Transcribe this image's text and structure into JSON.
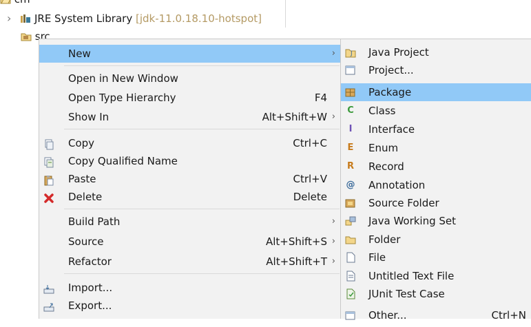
{
  "tree": {
    "project_label": "cm",
    "jre_label": "JRE System Library",
    "jre_decoration": "[jdk-11.0.18.10-hotspot]",
    "src_label": "src",
    "expand_glyph": "›"
  },
  "context_menu": {
    "items": [
      {
        "label": "New",
        "accel": "",
        "arrow": "›"
      },
      {
        "label": "Open in New Window",
        "accel": "",
        "arrow": ""
      },
      {
        "label": "Open Type Hierarchy",
        "accel": "F4",
        "arrow": ""
      },
      {
        "label": "Show In",
        "accel": "Alt+Shift+W",
        "arrow": "›"
      },
      {
        "label": "Copy",
        "accel": "Ctrl+C",
        "arrow": "",
        "icon": "copy-icon"
      },
      {
        "label": "Copy Qualified Name",
        "accel": "",
        "arrow": "",
        "icon": "copy-qualified-name-icon"
      },
      {
        "label": "Paste",
        "accel": "Ctrl+V",
        "arrow": "",
        "icon": "paste-icon"
      },
      {
        "label": "Delete",
        "accel": "Delete",
        "arrow": "",
        "icon": "delete-icon"
      },
      {
        "label": "Build Path",
        "accel": "",
        "arrow": "›"
      },
      {
        "label": "Source",
        "accel": "Alt+Shift+S",
        "arrow": "›"
      },
      {
        "label": "Refactor",
        "accel": "Alt+Shift+T",
        "arrow": "›"
      },
      {
        "label": "Import...",
        "accel": "",
        "arrow": "",
        "icon": "import-icon"
      },
      {
        "label": "Export...",
        "accel": "",
        "arrow": "",
        "icon": "export-icon"
      }
    ]
  },
  "submenu": {
    "items": [
      {
        "label": "Java Project",
        "icon": "java-project-icon"
      },
      {
        "label": "Project...",
        "icon": "project-icon"
      },
      {
        "label": "Package",
        "icon": "package-icon",
        "highlighted": true
      },
      {
        "label": "Class",
        "icon": "class-icon",
        "glyph": "C"
      },
      {
        "label": "Interface",
        "icon": "interface-icon",
        "glyph": "I"
      },
      {
        "label": "Enum",
        "icon": "enum-icon",
        "glyph": "E"
      },
      {
        "label": "Record",
        "icon": "record-icon",
        "glyph": "R"
      },
      {
        "label": "Annotation",
        "icon": "annotation-icon",
        "glyph": "@"
      },
      {
        "label": "Source Folder",
        "icon": "source-folder-icon"
      },
      {
        "label": "Java Working Set",
        "icon": "java-working-set-icon"
      },
      {
        "label": "Folder",
        "icon": "folder-icon"
      },
      {
        "label": "File",
        "icon": "file-icon"
      },
      {
        "label": "Untitled Text File",
        "icon": "untitled-text-file-icon"
      },
      {
        "label": "JUnit Test Case",
        "icon": "junit-test-case-icon"
      },
      {
        "label": "Other...",
        "icon": "other-wizard-icon",
        "accel": "Ctrl+N"
      }
    ]
  },
  "colors": {
    "highlight": "#91c9f7",
    "menu_bg": "#f2f2f2",
    "class_green": "#3c9a3c",
    "interface_purple": "#6f52b5",
    "enum_orange": "#c77b1c",
    "delete_red": "#d42a2a",
    "decoration": "#b49a64"
  }
}
